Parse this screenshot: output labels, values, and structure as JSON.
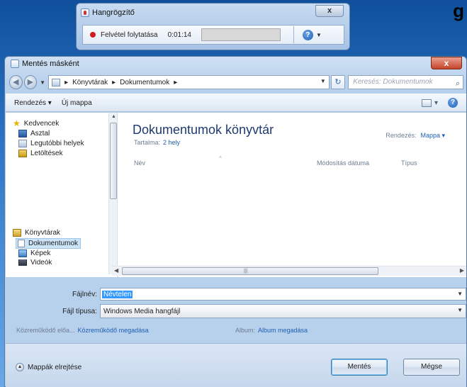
{
  "desktop": {
    "partial_text": "g"
  },
  "recorder": {
    "title": "Hangrögzítő",
    "close_glyph": "x",
    "status_label": "Felvétel folytatása",
    "elapsed": "0:01:14",
    "help_glyph": "?",
    "recording_color": "#d21b1b"
  },
  "dialog": {
    "title": "Mentés másként",
    "close_glyph": "x",
    "breadcrumb": [
      "Könyvtárak",
      "Dokumentumok"
    ],
    "search_placeholder": "Keresés: Dokumentumok",
    "toolbar": {
      "organize": "Rendezés ▾",
      "new_folder": "Új mappa",
      "view_glyph": "▾",
      "help_glyph": "?"
    },
    "nav": {
      "favorites": "Kedvencek",
      "items_fav": [
        "Asztal",
        "Legutóbbi helyek",
        "Letöltések"
      ],
      "libraries": "Könyvtárak",
      "items_lib": [
        "Dokumentumok",
        "Képek",
        "Videók"
      ]
    },
    "library": {
      "title": "Dokumentumok könyvtár",
      "includes_label": "Tartalma:",
      "includes_value": "2 hely",
      "arrange_label": "Rendezés:",
      "arrange_value": "Mappa ▾"
    },
    "columns": [
      "Név",
      "Módosítás dátuma",
      "Típus"
    ],
    "form": {
      "filename_label": "Fájlnév:",
      "filename_value": "Névtelen",
      "filetype_label": "Fájl típusa:",
      "filetype_value": "Windows Media hangfájl"
    },
    "meta": {
      "contrib_label": "Közreműködő előa...",
      "contrib_link": "Közreműködő megadása",
      "album_label": "Album:",
      "album_link": "Album megadása"
    },
    "hide_folders": "Mappák elrejtése",
    "save_button": "Mentés",
    "cancel_button": "Mégse",
    "accent_color": "#1d5fb5"
  }
}
